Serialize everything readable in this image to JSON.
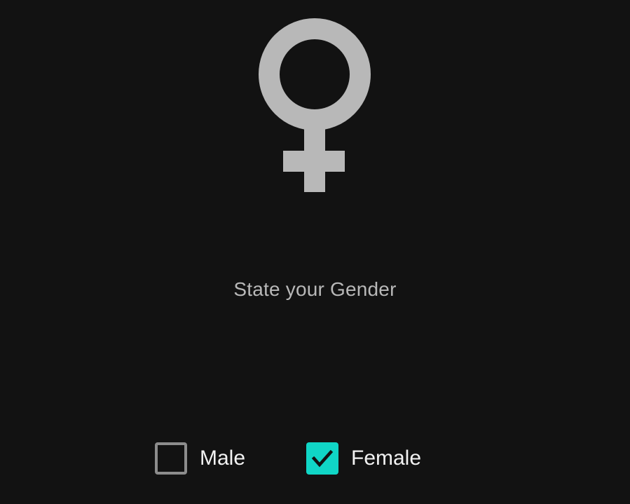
{
  "screen": {
    "icon": "female-symbol-icon",
    "prompt": "State your Gender"
  },
  "options": {
    "male": {
      "label": "Male",
      "checked": false
    },
    "female": {
      "label": "Female",
      "checked": true,
      "checkmark_icon": "checkmark-icon"
    }
  },
  "colors": {
    "background": "#121212",
    "symbol": "#b8b8b8",
    "prompt_text": "#b8b8b8",
    "label_text": "#f2f2f2",
    "accent": "#10d6c6",
    "checkbox_border": "#8c8c8c"
  }
}
